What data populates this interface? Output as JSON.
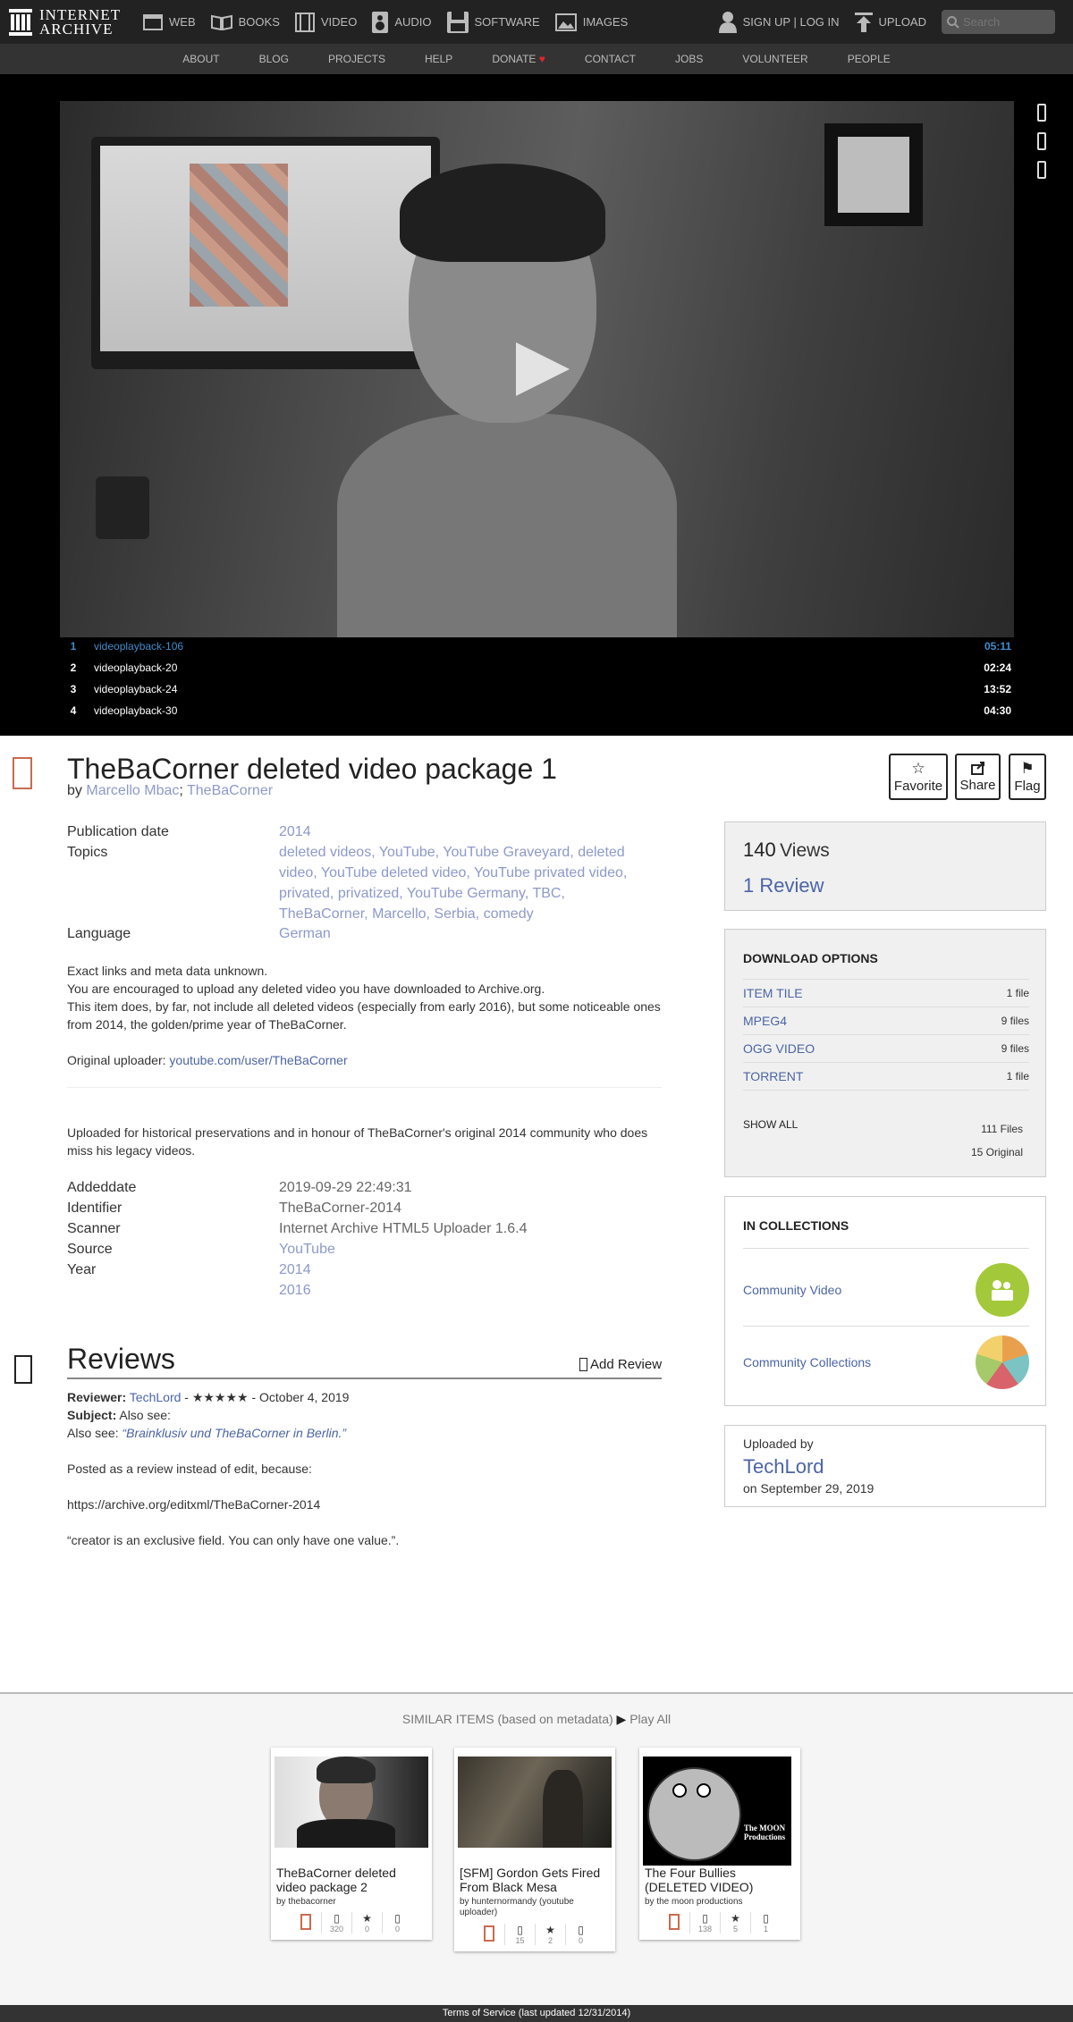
{
  "nav": {
    "logo_line1": "INTERNET",
    "logo_line2": "ARCHIVE",
    "web": "WEB",
    "books": "BOOKS",
    "video": "VIDEO",
    "audio": "AUDIO",
    "software": "SOFTWARE",
    "images": "IMAGES",
    "signin": "SIGN UP | LOG IN",
    "upload": "UPLOAD",
    "search_placeholder": "Search"
  },
  "subnav": [
    "ABOUT",
    "BLOG",
    "PROJECTS",
    "HELP",
    "DONATE",
    "CONTACT",
    "JOBS",
    "VOLUNTEER",
    "PEOPLE"
  ],
  "playlist": [
    {
      "num": "1",
      "name": "videoplayback-106",
      "dur": "05:11"
    },
    {
      "num": "2",
      "name": "videoplayback-20",
      "dur": "02:24"
    },
    {
      "num": "3",
      "name": "videoplayback-24",
      "dur": "13:52"
    },
    {
      "num": "4",
      "name": "videoplayback-30",
      "dur": "04:30"
    }
  ],
  "item": {
    "title": "TheBaCorner deleted video package 1",
    "by": "by",
    "creator1": "Marcello Mbac",
    "sep": ";",
    "creator2": "TheBaCorner",
    "favorite": "Favorite",
    "share": "Share",
    "flag": "Flag"
  },
  "meta": {
    "pub_key": "Publication date",
    "pub_val": "2014",
    "topics_key": "Topics",
    "topics": [
      "deleted videos",
      "YouTube",
      "YouTube Graveyard",
      "deleted video",
      "YouTube deleted video",
      "YouTube privated video",
      "privated",
      "privatized",
      "YouTube Germany",
      "TBC",
      "TheBaCorner",
      "Marcello",
      "Serbia",
      "comedy"
    ],
    "lang_key": "Language",
    "lang_val": "German"
  },
  "description": {
    "line1": "Exact links and meta data unknown.",
    "line2": "You are encouraged to upload any deleted video you have downloaded to Archive.org.",
    "line3": "This item does, by far, not include all deleted videos (especially from early 2016), but some noticeable ones from 2014, the golden/prime year of TheBaCorner.",
    "uploader_label": "Original uploader:",
    "uploader_link": "youtube.com/user/TheBaCorner",
    "notes": "Uploaded for historical preservations and in honour of TheBaCorner's original 2014 community who does miss his legacy videos."
  },
  "meta2": {
    "added_key": "Addeddate",
    "added_val": "2019-09-29 22:49:31",
    "ident_key": "Identifier",
    "ident_val": "TheBaCorner-2014",
    "scanner_key": "Scanner",
    "scanner_val": "Internet Archive HTML5 Uploader 1.6.4",
    "source_key": "Source",
    "source_val": "YouTube",
    "year_key": "Year",
    "year_val1": "2014",
    "year_val2": "2016"
  },
  "stats": {
    "views_num": "140",
    "views_label": "Views",
    "reviews": "1 Review"
  },
  "downloads": {
    "title": "DOWNLOAD OPTIONS",
    "rows": [
      {
        "label": "ITEM TILE",
        "count": "1 file"
      },
      {
        "label": "MPEG4",
        "count": "9 files"
      },
      {
        "label": "OGG VIDEO",
        "count": "9 files"
      },
      {
        "label": "TORRENT",
        "count": "1 file"
      }
    ],
    "show_all": "SHOW ALL",
    "total_files": "111 Files",
    "original": "15 Original"
  },
  "collections": {
    "title": "IN COLLECTIONS",
    "items": [
      "Community Video",
      "Community Collections"
    ]
  },
  "uploaded": {
    "label": "Uploaded by",
    "user": "TechLord",
    "date": "on September 29, 2019"
  },
  "reviews": {
    "heading": "Reviews",
    "add": "Add Review",
    "reviewer_label": "Reviewer:",
    "reviewer": "TechLord",
    "rating_date": "- ★★★★★ - October 4, 2019",
    "subject_label": "Subject:",
    "subject": "Also see:",
    "also_see_label": "Also see:",
    "also_see_link": "“Brainklusiv und TheBaCorner in Berlin.”",
    "posted": "Posted as a review instead of edit, because:",
    "link": "https://archive.org/editxml/TheBaCorner-2014",
    "quote": "“creator is an exclusive field. You can only have one value.”."
  },
  "similar": {
    "title": "SIMILAR ITEMS (based on metadata)",
    "play_all": "Play All",
    "items": [
      {
        "title": "TheBaCorner deleted video package 2",
        "by": "by thebacorner",
        "views": "320",
        "favs": "0",
        "reviews": "0"
      },
      {
        "title": "[SFM] Gordon Gets Fired From Black Mesa",
        "by": "by hunternormandy (youtube uploader)",
        "views": "15",
        "favs": "2",
        "reviews": "0"
      },
      {
        "title": "The Four Bullies (DELETED VIDEO)",
        "by": "by the moon productions",
        "views": "138",
        "favs": "5",
        "reviews": "1"
      }
    ]
  },
  "moon_caption": "The MOON Productions",
  "footer": "Terms of Service (last updated 12/31/2014)"
}
